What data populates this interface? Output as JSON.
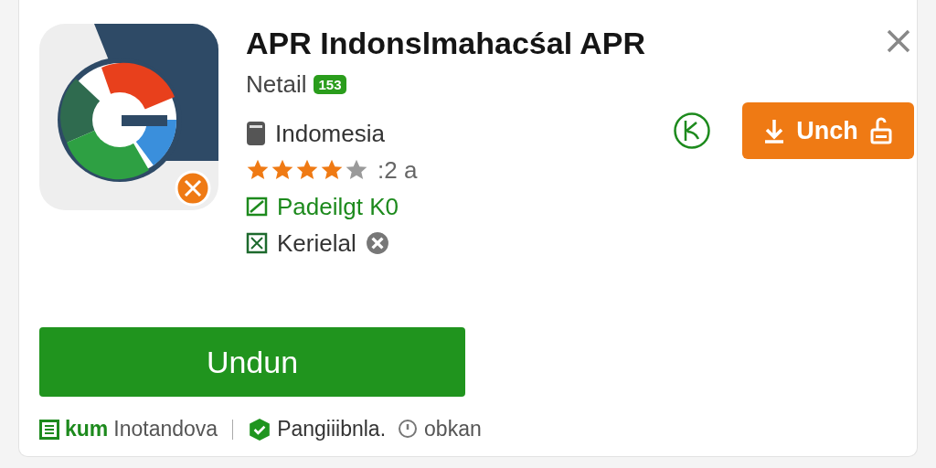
{
  "app": {
    "title": "APR Indonslmahacśal APR",
    "developer": "Netail",
    "badge": "153",
    "country": "Indomesia",
    "stars": 4,
    "rating_text": ":2 a",
    "feature": "Padeilgt K0",
    "category": "Kerielal"
  },
  "actions": {
    "secondary_button": "Unch",
    "primary_button": "Undun"
  },
  "footer": [
    {
      "kind": "link",
      "text": "kum",
      "rest": "Inotandova"
    },
    {
      "kind": "verified",
      "text": "Pangiiibnla."
    },
    {
      "kind": "info",
      "text": "obkan"
    }
  ]
}
